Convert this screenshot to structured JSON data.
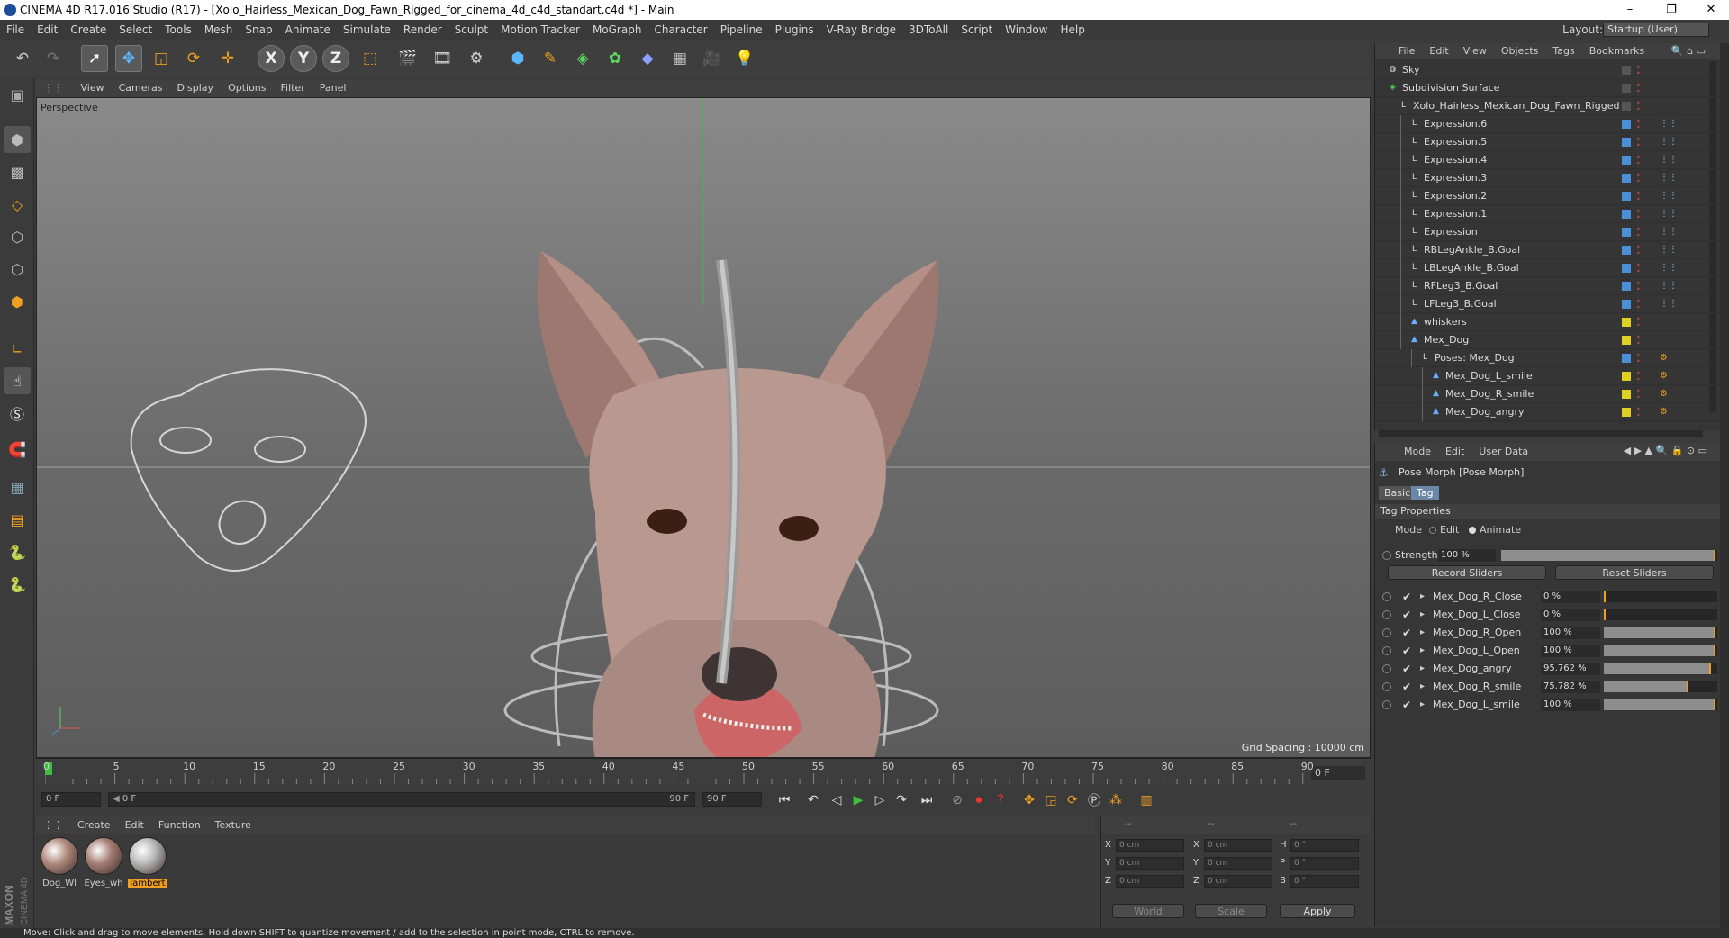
{
  "window": {
    "title": "CINEMA 4D R17.016 Studio (R17) - [Xolo_Hairless_Mexican_Dog_Fawn_Rigged_for_cinema_4d_c4d_standart.c4d *] - Main"
  },
  "menubar": [
    "File",
    "Edit",
    "Create",
    "Select",
    "Tools",
    "Mesh",
    "Snap",
    "Animate",
    "Simulate",
    "Render",
    "Sculpt",
    "Motion Tracker",
    "MoGraph",
    "Character",
    "Pipeline",
    "Plugins",
    "V-Ray Bridge",
    "3DToAll",
    "Script",
    "Window",
    "Help"
  ],
  "layout": {
    "label": "Layout:",
    "value": "Startup (User)"
  },
  "toolbar": {
    "axis_x": "X",
    "axis_y": "Y",
    "axis_z": "Z"
  },
  "viewport": {
    "menu": [
      "View",
      "Cameras",
      "Display",
      "Options",
      "Filter",
      "Panel"
    ],
    "camera_label": "Perspective",
    "grid_spacing": "Grid Spacing : 10000 cm"
  },
  "timeline": {
    "ticks": [
      "0",
      "5",
      "10",
      "15",
      "20",
      "25",
      "30",
      "35",
      "40",
      "45",
      "50",
      "55",
      "60",
      "65",
      "70",
      "75",
      "80",
      "85",
      "90"
    ],
    "current_frame": "0 F"
  },
  "transport": {
    "start": "0 F",
    "range_start": "0 F",
    "range_end": "90 F",
    "end": "90 F"
  },
  "materials": {
    "menu": [
      "Create",
      "Edit",
      "Function",
      "Texture"
    ],
    "items": [
      {
        "label": "Dog_Wl",
        "color": "#b08a7e"
      },
      {
        "label": "Eyes_wh",
        "color": "#a47e74"
      },
      {
        "label": "lambert",
        "color": "#b8b8b8"
      }
    ]
  },
  "coordinates": {
    "header": [
      "--",
      "--",
      "--"
    ],
    "rows": [
      {
        "a": "X",
        "av": "0 cm",
        "b": "X",
        "bv": "0 cm",
        "c": "H",
        "cv": "0 °"
      },
      {
        "a": "Y",
        "av": "0 cm",
        "b": "Y",
        "bv": "0 cm",
        "c": "P",
        "cv": "0 °"
      },
      {
        "a": "Z",
        "av": "0 cm",
        "b": "Z",
        "bv": "0 cm",
        "c": "B",
        "cv": "0 °"
      }
    ],
    "mode1": "World",
    "mode2": "Scale",
    "apply": "Apply"
  },
  "status": "Move: Click and drag to move elements. Hold down SHIFT to quantize movement / add to the selection in point mode, CTRL to remove.",
  "objects": {
    "menu": [
      "File",
      "Edit",
      "View",
      "Objects",
      "Tags",
      "Bookmarks"
    ],
    "rows": [
      {
        "name": "Sky",
        "indent": 0,
        "swatch": "#555555",
        "icon": "sky"
      },
      {
        "name": "Subdivision Surface",
        "indent": 0,
        "swatch": "#555555",
        "icon": "subdiv"
      },
      {
        "name": "Xolo_Hairless_Mexican_Dog_Fawn_Rigged",
        "indent": 1,
        "swatch": "#555555",
        "icon": "null"
      },
      {
        "name": "Expression.6",
        "indent": 2,
        "swatch": "#4a8fd8",
        "icon": "null"
      },
      {
        "name": "Expression.5",
        "indent": 2,
        "swatch": "#4a8fd8",
        "icon": "null"
      },
      {
        "name": "Expression.4",
        "indent": 2,
        "swatch": "#4a8fd8",
        "icon": "null"
      },
      {
        "name": "Expression.3",
        "indent": 2,
        "swatch": "#4a8fd8",
        "icon": "null"
      },
      {
        "name": "Expression.2",
        "indent": 2,
        "swatch": "#4a8fd8",
        "icon": "null"
      },
      {
        "name": "Expression.1",
        "indent": 2,
        "swatch": "#4a8fd8",
        "icon": "null"
      },
      {
        "name": "Expression",
        "indent": 2,
        "swatch": "#4a8fd8",
        "icon": "null"
      },
      {
        "name": "RBLegAnkle_B.Goal",
        "indent": 2,
        "swatch": "#4a8fd8",
        "icon": "null"
      },
      {
        "name": "LBLegAnkle_B.Goal",
        "indent": 2,
        "swatch": "#4a8fd8",
        "icon": "null"
      },
      {
        "name": "RFLeg3_B.Goal",
        "indent": 2,
        "swatch": "#4a8fd8",
        "icon": "null"
      },
      {
        "name": "LFLeg3_B.Goal",
        "indent": 2,
        "swatch": "#4a8fd8",
        "icon": "null"
      },
      {
        "name": "whiskers",
        "indent": 2,
        "swatch": "#e0d020",
        "icon": "poly"
      },
      {
        "name": "Mex_Dog",
        "indent": 2,
        "swatch": "#e0d020",
        "icon": "poly"
      },
      {
        "name": "Poses: Mex_Dog",
        "indent": 3,
        "swatch": "#4a8fd8",
        "icon": "null"
      },
      {
        "name": "Mex_Dog_L_smile",
        "indent": 4,
        "swatch": "#e0d020",
        "icon": "poly"
      },
      {
        "name": "Mex_Dog_R_smile",
        "indent": 4,
        "swatch": "#e0d020",
        "icon": "poly"
      },
      {
        "name": "Mex_Dog_angry",
        "indent": 4,
        "swatch": "#e0d020",
        "icon": "poly"
      }
    ]
  },
  "attributes": {
    "menu": [
      "Mode",
      "Edit",
      "User Data"
    ],
    "title": "Pose Morph [Pose Morph]",
    "tabs": [
      "Basic",
      "Tag"
    ],
    "section": "Tag Properties",
    "mode_label": "Mode",
    "mode_edit": "Edit",
    "mode_animate": "Animate",
    "strength_label": "Strength",
    "strength_value": "100 %",
    "strength": 1.0,
    "record": "Record Sliders",
    "reset": "Reset Sliders",
    "sliders": [
      {
        "name": "Mex_Dog_R_Close",
        "value": "0 %",
        "level": 0.0
      },
      {
        "name": "Mex_Dog_L_Close",
        "value": "0 %",
        "level": 0.0
      },
      {
        "name": "Mex_Dog_R_Open",
        "value": "100 %",
        "level": 1.0
      },
      {
        "name": "Mex_Dog_L_Open",
        "value": "100 %",
        "level": 1.0
      },
      {
        "name": "Mex_Dog_angry",
        "value": "95.762 %",
        "level": 0.95762
      },
      {
        "name": "Mex_Dog_R_smile",
        "value": "75.782 %",
        "level": 0.75782
      },
      {
        "name": "Mex_Dog_L_smile",
        "value": "100 %",
        "level": 1.0
      }
    ]
  }
}
